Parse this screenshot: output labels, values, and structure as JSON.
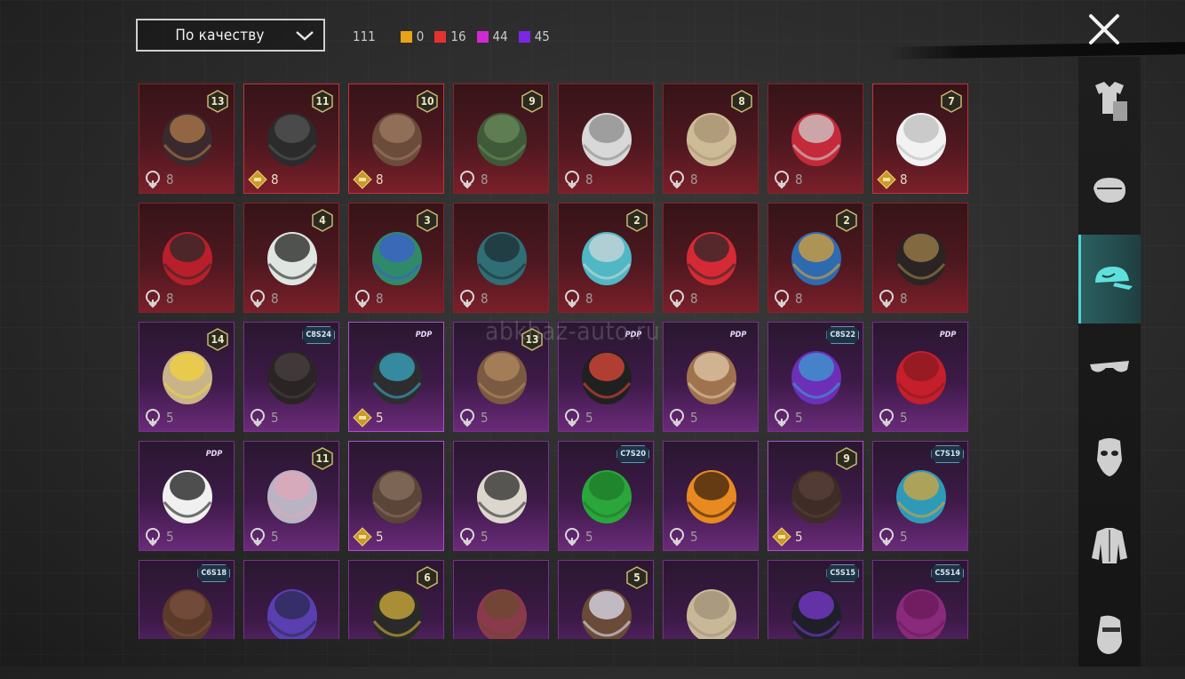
{
  "sort": {
    "label": "По качеству"
  },
  "counts": {
    "total": "111",
    "tiers": [
      {
        "color": "#e8a317",
        "value": "0"
      },
      {
        "color": "#e53131",
        "value": "16"
      },
      {
        "color": "#d02ad0",
        "value": "44"
      },
      {
        "color": "#7a28e6",
        "value": "45"
      }
    ]
  },
  "watermark": "abkhaz-auto.ru",
  "sidebar_tabs": [
    {
      "icon": "outfit-icon",
      "active": false
    },
    {
      "icon": "face-mask-icon",
      "active": false
    },
    {
      "icon": "cap-icon",
      "active": true
    },
    {
      "icon": "glasses-icon",
      "active": false
    },
    {
      "icon": "mask-icon",
      "active": false
    },
    {
      "icon": "jacket-icon",
      "active": false
    },
    {
      "icon": "character-icon",
      "active": false
    }
  ],
  "items": [
    {
      "tier": "red",
      "badge": "13",
      "badge_type": "level",
      "res": "8",
      "gold": false,
      "art": "hat-hair"
    },
    {
      "tier": "red",
      "badge": "11",
      "badge_type": "level",
      "res": "8",
      "gold": true,
      "art": "helmet-dark"
    },
    {
      "tier": "red",
      "badge": "10",
      "badge_type": "level",
      "res": "8",
      "gold": true,
      "art": "hair-brown"
    },
    {
      "tier": "red",
      "badge": "9",
      "badge_type": "level",
      "res": "8",
      "gold": false,
      "art": "zombie-head"
    },
    {
      "tier": "red",
      "badge": "",
      "badge_type": "none",
      "res": "8",
      "gold": false,
      "art": "cowboy-hat"
    },
    {
      "tier": "red",
      "badge": "8",
      "badge_type": "level",
      "res": "8",
      "gold": false,
      "art": "hair-blonde"
    },
    {
      "tier": "red",
      "badge": "",
      "badge_type": "none",
      "res": "8",
      "gold": false,
      "art": "oni-mask"
    },
    {
      "tier": "red",
      "badge": "7",
      "badge_type": "level",
      "res": "8",
      "gold": true,
      "art": "hair-white"
    },
    {
      "tier": "red",
      "badge": "",
      "badge_type": "none",
      "res": "8",
      "gold": false,
      "art": "helmet-red"
    },
    {
      "tier": "red",
      "badge": "4",
      "badge_type": "level",
      "res": "8",
      "gold": false,
      "art": "snowman"
    },
    {
      "tier": "red",
      "badge": "3",
      "badge_type": "level",
      "res": "8",
      "gold": false,
      "art": "curly-green"
    },
    {
      "tier": "red",
      "badge": "",
      "badge_type": "none",
      "res": "8",
      "gold": false,
      "art": "dragon-helmet"
    },
    {
      "tier": "red",
      "badge": "2",
      "badge_type": "level",
      "res": "8",
      "gold": false,
      "art": "bucket-hat"
    },
    {
      "tier": "red",
      "badge": "",
      "badge_type": "none",
      "res": "8",
      "gold": false,
      "art": "cyber-helmet"
    },
    {
      "tier": "red",
      "badge": "2",
      "badge_type": "level",
      "res": "8",
      "gold": false,
      "art": "samurai-helmet"
    },
    {
      "tier": "red",
      "badge": "",
      "badge_type": "none",
      "res": "8",
      "gold": false,
      "art": "tricorn"
    },
    {
      "tier": "purple",
      "badge": "14",
      "badge_type": "level",
      "res": "5",
      "gold": false,
      "art": "hair-flower"
    },
    {
      "tier": "purple",
      "badge": "C8S24",
      "badge_type": "tag",
      "res": "5",
      "gold": false,
      "art": "hair-black"
    },
    {
      "tier": "purple",
      "badge": "PDP",
      "badge_type": "pdp",
      "res": "5",
      "gold": true,
      "art": "hair-ribbon"
    },
    {
      "tier": "purple",
      "badge": "13",
      "badge_type": "level",
      "res": "5",
      "gold": false,
      "art": "goggles-hat"
    },
    {
      "tier": "purple",
      "badge": "PDP",
      "badge_type": "pdp",
      "res": "5",
      "gold": false,
      "art": "cap-goggles"
    },
    {
      "tier": "purple",
      "badge": "PDP",
      "badge_type": "pdp",
      "res": "5",
      "gold": false,
      "art": "dog-mask"
    },
    {
      "tier": "purple",
      "badge": "C8S22",
      "badge_type": "tag",
      "res": "5",
      "gold": false,
      "art": "hair-purple"
    },
    {
      "tier": "purple",
      "badge": "PDP",
      "badge_type": "pdp",
      "res": "5",
      "gold": false,
      "art": "hair-red"
    },
    {
      "tier": "purple",
      "badge": "PDP",
      "badge_type": "pdp",
      "res": "5",
      "gold": false,
      "art": "panda-mask"
    },
    {
      "tier": "purple",
      "badge": "11",
      "badge_type": "level",
      "res": "5",
      "gold": false,
      "art": "veil-hair"
    },
    {
      "tier": "purple",
      "badge": "",
      "badge_type": "none",
      "res": "5",
      "gold": true,
      "art": "ponytail"
    },
    {
      "tier": "purple",
      "badge": "",
      "badge_type": "none",
      "res": "5",
      "gold": false,
      "art": "fur-hat"
    },
    {
      "tier": "purple",
      "badge": "C7S20",
      "badge_type": "tag",
      "res": "5",
      "gold": false,
      "art": "hair-green"
    },
    {
      "tier": "purple",
      "badge": "",
      "badge_type": "none",
      "res": "5",
      "gold": false,
      "art": "pumpkin"
    },
    {
      "tier": "purple",
      "badge": "9",
      "badge_type": "level",
      "res": "5",
      "gold": true,
      "art": "hair-long-dark"
    },
    {
      "tier": "purple",
      "badge": "C7S19",
      "badge_type": "tag",
      "res": "5",
      "gold": false,
      "art": "feather-headdress"
    },
    {
      "tier": "purple",
      "badge": "C6S18",
      "badge_type": "tag",
      "res": "",
      "gold": false,
      "art": "hair-short-brown"
    },
    {
      "tier": "purple",
      "badge": "",
      "badge_type": "none",
      "res": "",
      "gold": false,
      "art": "space-helmet"
    },
    {
      "tier": "purple",
      "badge": "6",
      "badge_type": "level",
      "res": "",
      "gold": false,
      "art": "knight-helmet"
    },
    {
      "tier": "purple",
      "badge": "",
      "badge_type": "none",
      "res": "",
      "gold": false,
      "art": "witch-hat"
    },
    {
      "tier": "purple",
      "badge": "5",
      "badge_type": "level",
      "res": "",
      "gold": false,
      "art": "hair-bows"
    },
    {
      "tier": "purple",
      "badge": "",
      "badge_type": "none",
      "res": "",
      "gold": false,
      "art": "hair-curly-blonde"
    },
    {
      "tier": "purple",
      "badge": "C5S15",
      "badge_type": "tag",
      "res": "",
      "gold": false,
      "art": "cap-dark"
    },
    {
      "tier": "purple",
      "badge": "C5S14",
      "badge_type": "tag",
      "res": "",
      "gold": false,
      "art": "hair-magenta"
    }
  ]
}
